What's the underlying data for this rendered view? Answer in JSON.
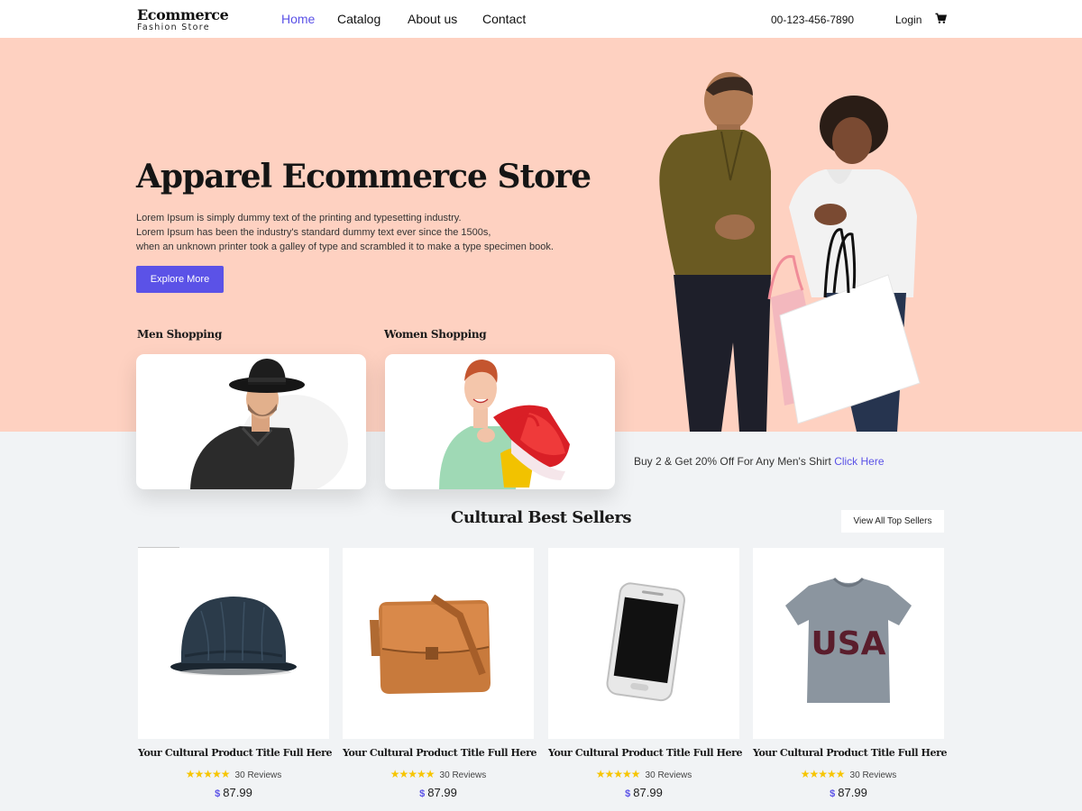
{
  "brand": {
    "title": "Ecommerce",
    "subtitle": "Fashion Store"
  },
  "nav": {
    "items": [
      {
        "label": "Home",
        "active": true
      },
      {
        "label": "Catalog",
        "active": false
      },
      {
        "label": "About us",
        "active": false
      },
      {
        "label": "Contact",
        "active": false
      }
    ],
    "phone": "00-123-456-7890",
    "login": "Login",
    "cart_icon": "cart-icon"
  },
  "hero": {
    "title": "Apparel Ecommerce Store",
    "description": [
      "Lorem Ipsum is simply dummy text of the printing and typesetting industry.",
      "Lorem Ipsum has been the industry's standard dummy text ever since the 1500s,",
      "when an unknown printer took a galley of type and scrambled it to make a type specimen book."
    ],
    "button": "Explore More",
    "categories": [
      {
        "label": "Men Shopping"
      },
      {
        "label": "Women Shopping"
      }
    ]
  },
  "promo": {
    "text": "Buy 2 & Get 20% Off For Any Men's Shirt",
    "link": "Click Here"
  },
  "best_sellers": {
    "title": "Cultural Best Sellers",
    "view_all": "View All Top Sellers",
    "products": [
      {
        "title": "Your Cultural Product Title Full Here",
        "stars": "★★★★★",
        "reviews": "30 Reviews",
        "currency": "$",
        "price": "87.99"
      },
      {
        "title": "Your Cultural Product Title Full Here",
        "stars": "★★★★★",
        "reviews": "30 Reviews",
        "currency": "$",
        "price": "87.99"
      },
      {
        "title": "Your Cultural Product Title Full Here",
        "stars": "★★★★★",
        "reviews": "30 Reviews",
        "currency": "$",
        "price": "87.99"
      },
      {
        "title": "Your Cultural Product Title Full Here",
        "stars": "★★★★★",
        "reviews": "30 Reviews",
        "currency": "$",
        "price": "87.99"
      }
    ]
  },
  "colors": {
    "accent": "#5b52e7",
    "hero_bg": "#fed1c1",
    "page_bg": "#f1f3f5",
    "star": "#f7c500"
  }
}
